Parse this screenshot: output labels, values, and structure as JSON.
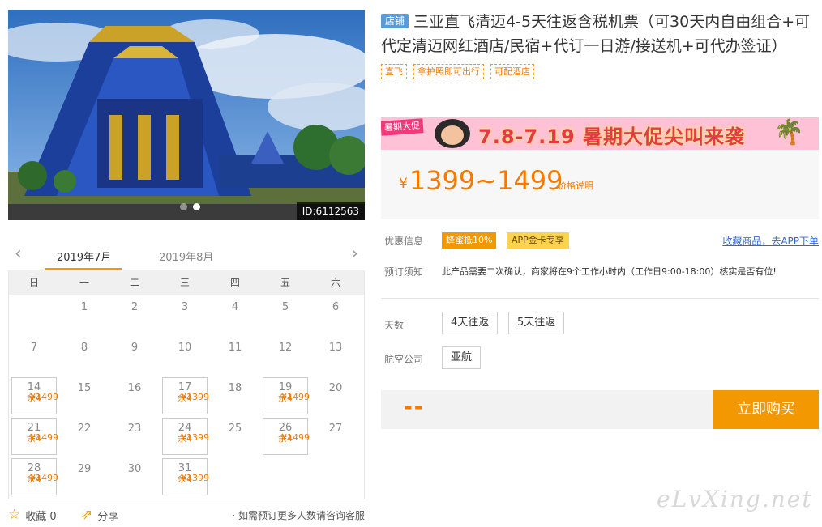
{
  "hero": {
    "id_label": "ID:6112563"
  },
  "calendar": {
    "months": [
      "2019年7月",
      "2019年8月"
    ],
    "weekdays": [
      "日",
      "一",
      "二",
      "三",
      "四",
      "五",
      "六"
    ],
    "days": [
      {
        "d": ""
      },
      {
        "d": "1"
      },
      {
        "d": "2"
      },
      {
        "d": "3"
      },
      {
        "d": "4"
      },
      {
        "d": "5"
      },
      {
        "d": "6"
      },
      {
        "d": "7"
      },
      {
        "d": "8"
      },
      {
        "d": "9"
      },
      {
        "d": "10"
      },
      {
        "d": "11"
      },
      {
        "d": "12"
      },
      {
        "d": "13"
      },
      {
        "d": "14",
        "price": "¥1499",
        "left": "余4"
      },
      {
        "d": "15"
      },
      {
        "d": "16"
      },
      {
        "d": "17",
        "price": "¥1399",
        "left": "余4"
      },
      {
        "d": "18"
      },
      {
        "d": "19",
        "price": "¥1499",
        "left": "余4"
      },
      {
        "d": "20"
      },
      {
        "d": "21",
        "price": "¥1499",
        "left": "余4"
      },
      {
        "d": "22"
      },
      {
        "d": "23"
      },
      {
        "d": "24",
        "price": "¥1399",
        "left": "余4"
      },
      {
        "d": "25"
      },
      {
        "d": "26",
        "price": "¥1499",
        "left": "余4"
      },
      {
        "d": "27"
      },
      {
        "d": "28",
        "price": "¥1499",
        "left": "余4"
      },
      {
        "d": "29"
      },
      {
        "d": "30"
      },
      {
        "d": "31",
        "price": "¥1399",
        "left": "余4"
      }
    ],
    "favorite_label": "收藏 0",
    "share_label": "分享",
    "note": "· 如需预订更多人数请咨询客服"
  },
  "product": {
    "shop_tag": "店铺",
    "title": "三亚直飞清迈4-5天往返含税机票（可30天内自由组合+可代定清迈网红酒店/民宿+代订一日游/接送机+可代办签证）",
    "tags": [
      "直飞",
      "拿护照即可出行",
      "可配酒店"
    ],
    "promo": {
      "badge": "暑期大促",
      "text": "7.8-7.19 暑期大促尖叫来袭"
    },
    "price": {
      "currency": "¥",
      "range": "1399~1499",
      "note": "价格说明"
    },
    "offers_label": "优惠信息",
    "coupon1": "蜂蜜抵10%",
    "coupon2": "APP金卡专享",
    "app_link": "收藏商品，去APP下单",
    "notice_label": "预订须知",
    "notice": "此产品需要二次确认，商家将在9个工作小时内（工作日9:00-18:00）核实是否有位!",
    "days_label": "天数",
    "day_options": [
      "4天往返",
      "5天往返"
    ],
    "airline_label": "航空公司",
    "airline_option": "亚航",
    "qty_placeholder": "--",
    "buy_label": "立即购买"
  },
  "watermark": "eLvXing.net"
}
